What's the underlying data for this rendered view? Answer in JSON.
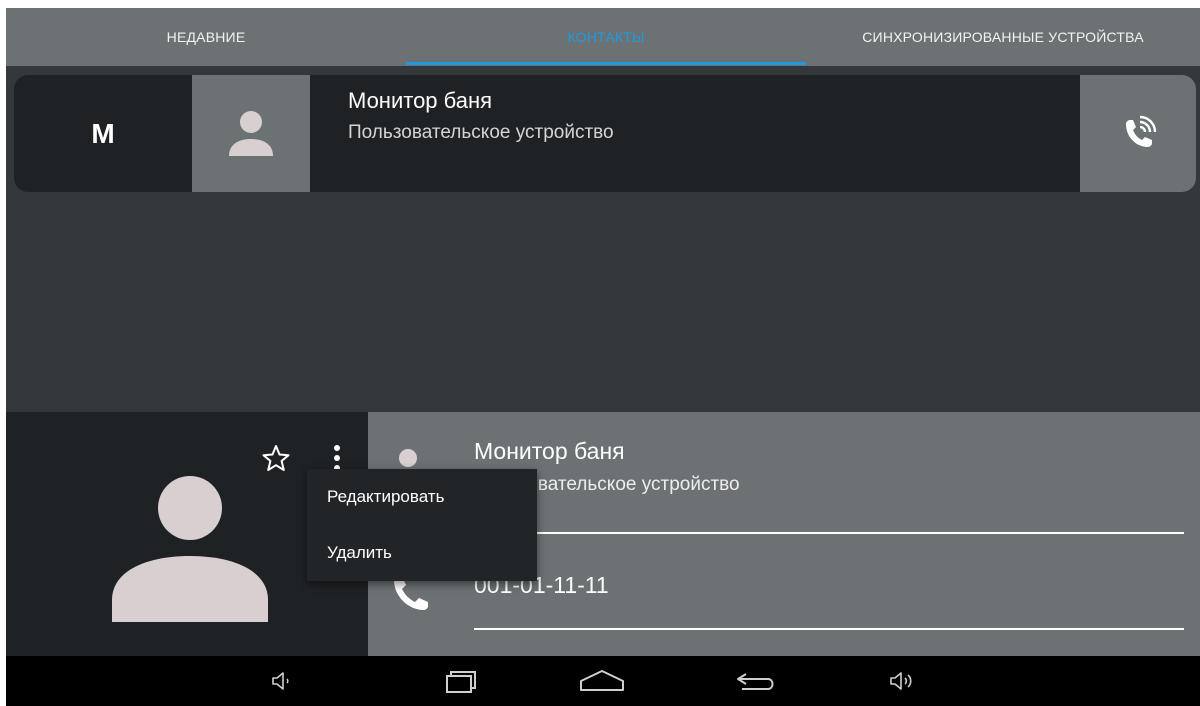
{
  "tabs": {
    "recent": "НЕДАВНИЕ",
    "contacts": "КОНТАКТЫ",
    "synced": "СИНХРОНИЗИРОВАННЫЕ УСТРОЙСТВА",
    "active": "contacts"
  },
  "contact": {
    "letter": "М",
    "name": "Монитор баня",
    "type": "Пользовательское устройство"
  },
  "details": {
    "name": "Монитор баня",
    "type": "Пользовательское устройство",
    "number": "001-01-11-11"
  },
  "popup_menu": {
    "items": [
      "Редактировать",
      "Удалить"
    ]
  },
  "icons": {
    "row_avatar": "person-icon",
    "call": "phone-ringing-icon",
    "favorite": "star-outline-icon",
    "more": "more-vert-icon",
    "nav": [
      "volume-down-icon",
      "recent-apps-icon",
      "home-icon",
      "back-icon",
      "volume-up-icon"
    ]
  },
  "colors": {
    "accent": "#1e9be0",
    "tab_bg": "#6c7274",
    "card_bg": "#1f2225",
    "screen_bg": "#34373b",
    "avatar_fill": "#d8cfd1"
  }
}
